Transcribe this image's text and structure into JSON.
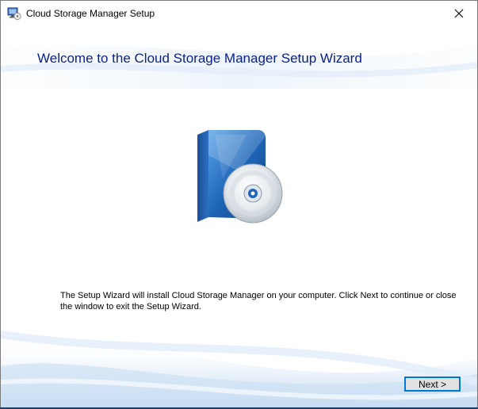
{
  "window": {
    "title": "Cloud Storage Manager Setup"
  },
  "header": {
    "title": "Welcome to the Cloud Storage Manager Setup Wizard"
  },
  "body": {
    "description": "The Setup Wizard will install Cloud Storage Manager on your computer. Click Next to continue or close the window to exit the Setup Wizard."
  },
  "footer": {
    "next_label": "Next >"
  },
  "icons": {
    "app": "setup-app-icon",
    "close": "close-icon",
    "product": "software-box-cd-icon"
  },
  "colors": {
    "title_text": "#0b1f8a",
    "button_border": "#0078d7",
    "button_face": "#e1e1e1",
    "wave_light": "#dbe9f7",
    "wave_mid": "#a9c9ec"
  }
}
